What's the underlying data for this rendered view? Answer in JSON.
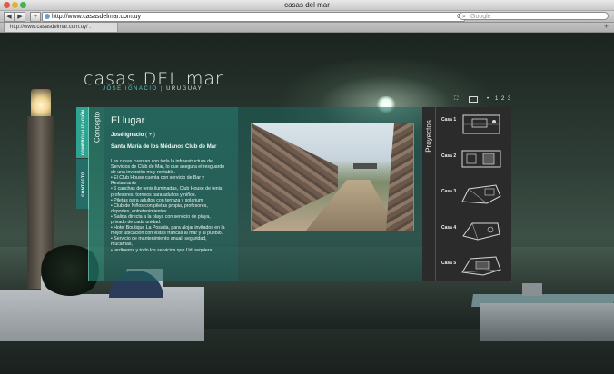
{
  "window": {
    "title": "casas del mar"
  },
  "toolbar": {
    "back": "◀",
    "forward": "▶",
    "add": "+",
    "url": "http://www.casasdelmar.com.uy",
    "reload": "C",
    "search_placeholder": "Google"
  },
  "tabs": [
    {
      "label": "http://www.casasdelmar.com.uy/ ."
    }
  ],
  "site": {
    "logo": "casas DEL mar",
    "subtitle_a": "JOSE IGNACIO",
    "subtitle_sep": "|",
    "subtitle_b": "URUGUAY"
  },
  "controls": {
    "pages": [
      "1",
      "2",
      "3"
    ],
    "dot": "•"
  },
  "side_tabs": {
    "comercializacion": "COMERCIALIZACIÓN",
    "contacto": "CONTACTO",
    "concepto": "Concepto"
  },
  "content": {
    "heading": "El lugar",
    "place": "José Ignacio",
    "place_more": " ( + )",
    "club": "Santa María de los Médanos Club de Mar",
    "body": [
      "Las casas cuentan con toda la infraestructura de",
      "Servicios de Club de Mar, lo que asegura el resguardo",
      "de una inversión muy rentable.",
      "• El Club House cuenta con servicio de Bar y",
      "Restaurante",
      "• 6 canchas de tenis iluminadas, Club House de tenis,",
      "profesores, torneos para adultos y niños.",
      "• Piletas para adultos con terraza y solarium",
      "• Club de Niños con piletas propia, profesores,",
      "deportes, entretenimientos.",
      "• Salida directa a la playa con servicio de playa,",
      "privado de cada unidad.",
      "• Hotel Boutique La Posada, para alojar invitados en la",
      "mejor ubicación con vistas francas al mar y al pueblo.",
      "• Servicio de mantenimiento anual, seguridad,",
      "mucamas,",
      "• jardineros y todo los servicios que Ud. requiera."
    ]
  },
  "proyectos": {
    "title": "Proyectos",
    "items": [
      "Casa 1",
      "Casa 2",
      "Casa 3",
      "Casa 4",
      "Casa 5"
    ]
  }
}
